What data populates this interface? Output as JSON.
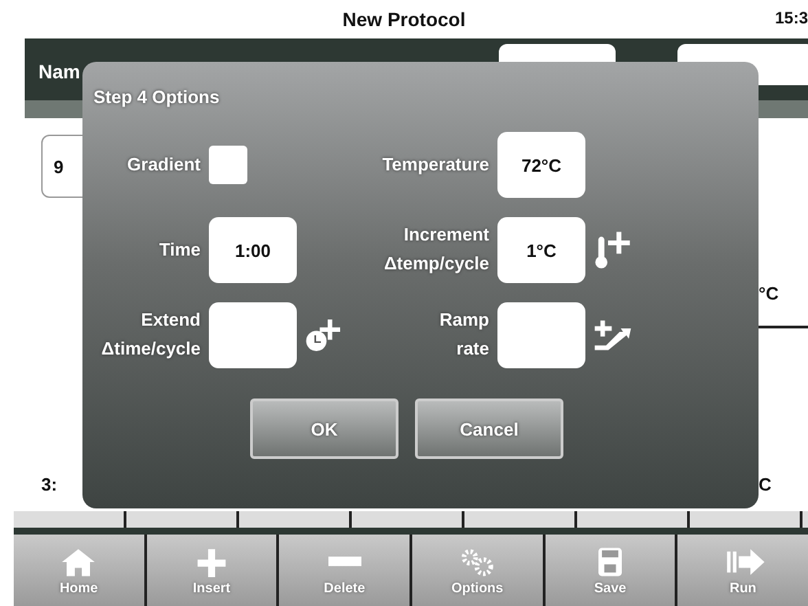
{
  "header": {
    "title": "New Protocol",
    "time": "15:3"
  },
  "background": {
    "name_label": "Nam",
    "left_cells": [
      "9",
      "3:"
    ],
    "right_cells": [
      "°C",
      "C"
    ]
  },
  "dialog": {
    "title": "Step 4 Options",
    "fields": [
      {
        "kind": "checkbox",
        "label_lines": [
          "Gradient"
        ],
        "checked": false
      },
      {
        "kind": "value",
        "label_lines": [
          "Temperature"
        ],
        "value": "72°C"
      },
      {
        "kind": "value",
        "label_lines": [
          "Time"
        ],
        "value": "1:00"
      },
      {
        "kind": "temp-step",
        "label_lines": [
          "Increment",
          "Δtemp/cycle"
        ],
        "value": "1°C"
      },
      {
        "kind": "time-step",
        "label_lines": [
          "Extend",
          "Δtime/cycle"
        ]
      },
      {
        "kind": "ramp",
        "label_lines": [
          "Ramp",
          "rate"
        ]
      }
    ],
    "buttons": [
      "OK",
      "Cancel"
    ]
  },
  "toolbar": [
    {
      "kind": "home",
      "label": "Home"
    },
    {
      "kind": "insert",
      "label": "Insert"
    },
    {
      "kind": "delete",
      "label": "Delete"
    },
    {
      "kind": "options",
      "label": "Options"
    },
    {
      "kind": "save",
      "label": "Save"
    },
    {
      "kind": "run",
      "label": "Run"
    }
  ]
}
